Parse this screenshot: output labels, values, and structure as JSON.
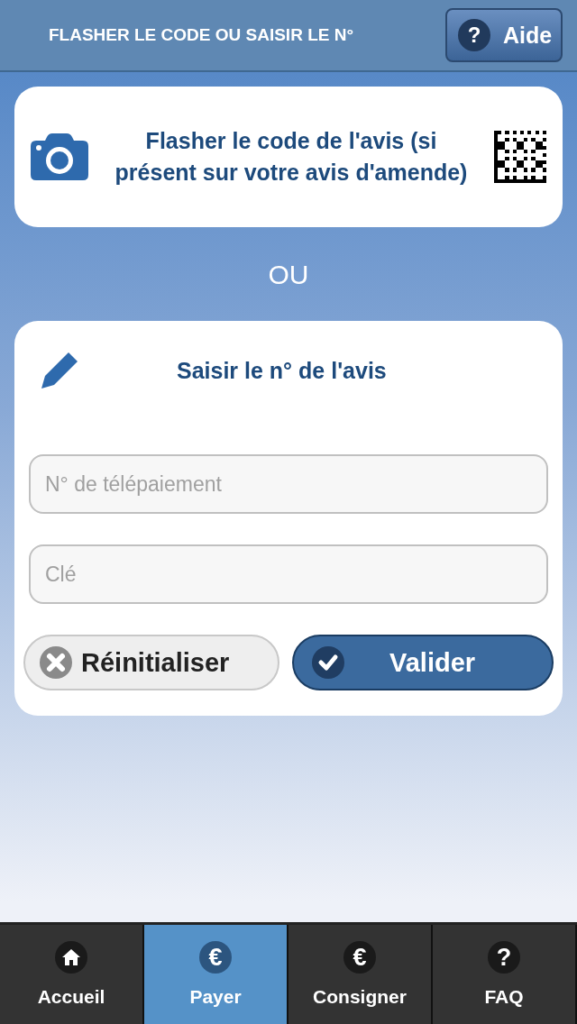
{
  "header": {
    "title": "FLASHER LE CODE OU SAISIR LE N°",
    "help_button": {
      "glyph": "?",
      "label": "Aide"
    }
  },
  "scan_card": {
    "text": "Flasher le code de l'avis (si présent sur votre avis d'amende)"
  },
  "separator": "OU",
  "entry_card": {
    "title": "Saisir le n° de l'avis",
    "fields": [
      {
        "placeholder": "N° de télépaiement"
      },
      {
        "placeholder": "Clé"
      }
    ],
    "buttons": [
      {
        "kind": "reset",
        "label": "Réinitialiser"
      },
      {
        "kind": "submit",
        "label": "Valider"
      }
    ]
  },
  "tabs": [
    {
      "kind": "home",
      "label": "Accueil",
      "selected": false
    },
    {
      "kind": "glyph",
      "glyph": "€",
      "label": "Payer",
      "selected": true
    },
    {
      "kind": "glyph",
      "glyph": "€",
      "label": "Consigner",
      "selected": false
    },
    {
      "kind": "glyph",
      "glyph": "?",
      "label": "FAQ",
      "selected": false
    }
  ]
}
